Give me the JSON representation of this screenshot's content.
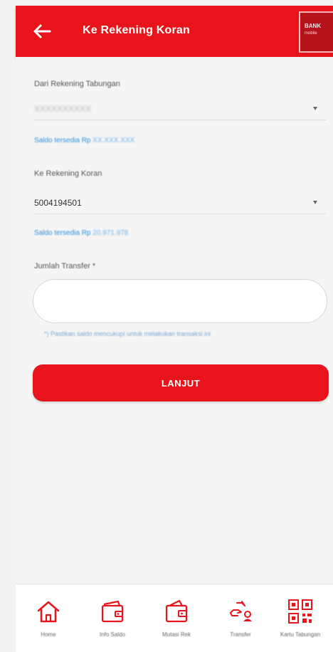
{
  "header": {
    "title": "Ke Rekening Koran",
    "logo_top": "BANK",
    "logo_bottom": "mobile"
  },
  "form": {
    "from_label": "Dari Rekening Tabungan",
    "from_value": "XXXXXXXXXX",
    "from_balance_label": "Saldo tersedia Rp",
    "from_balance_value": "XX.XXX.XXX",
    "to_label": "Ke Rekening Koran",
    "to_value": "5004194501",
    "to_balance_label": "Saldo tersedia Rp",
    "to_balance_value": "20.971.978",
    "amount_label": "Jumlah Transfer *",
    "amount_value": "",
    "hint": "*) Pastikan saldo mencukupi untuk melakukan transaksi ini"
  },
  "next_button_label": "LANJUT",
  "bottom_nav": [
    {
      "label": "Home",
      "icon": "home-icon"
    },
    {
      "label": "Info Saldo",
      "icon": "wallet-icon"
    },
    {
      "label": "Mutasi Rek",
      "icon": "mutation-icon"
    },
    {
      "label": "Transfer",
      "icon": "transfer-icon"
    },
    {
      "label": "Kartu Tabungan",
      "icon": "qr-code-icon"
    }
  ],
  "colors": {
    "brand_red": "#e8141b",
    "link_blue": "#2c8fd6",
    "background": "#f3f3f3"
  }
}
